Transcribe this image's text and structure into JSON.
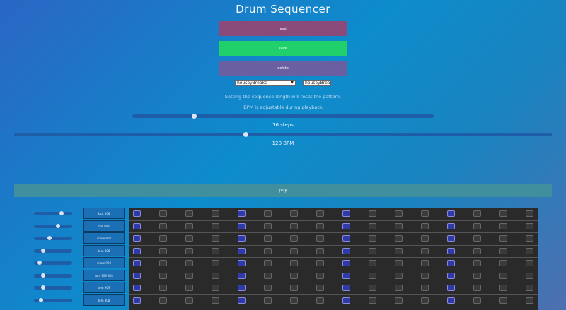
{
  "header": {
    "title": "Drum Sequencer"
  },
  "buttons": {
    "reset": "reset",
    "save": "save",
    "delete": "delete"
  },
  "controls": {
    "preset_select": "houseyBreaks",
    "name_input": "houseyBreaks",
    "note_reset": "Setting the sequence length will reset the pattern.",
    "note_bpm": "BPM is adjustable during playback",
    "steps_label": "16 steps",
    "steps_fraction": 0.2,
    "bpm_label": "120 BPM",
    "bpm_fraction": 0.43,
    "play_label": "play"
  },
  "tracks": [
    {
      "label": "kick 808",
      "volume": 0.75,
      "pattern": [
        1,
        0,
        0,
        0,
        1,
        0,
        0,
        0,
        1,
        0,
        0,
        0,
        1,
        0,
        0,
        0
      ]
    },
    {
      "label": "hat 808",
      "volume": 0.65,
      "pattern": [
        1,
        0,
        0,
        0,
        1,
        0,
        0,
        0,
        1,
        0,
        0,
        0,
        1,
        0,
        0,
        0
      ]
    },
    {
      "label": "snare 808",
      "volume": 0.4,
      "pattern": [
        1,
        0,
        0,
        0,
        1,
        0,
        0,
        0,
        1,
        0,
        0,
        0,
        1,
        0,
        0,
        0
      ]
    },
    {
      "label": "tom 808",
      "volume": 0.2,
      "pattern": [
        1,
        0,
        0,
        0,
        1,
        0,
        0,
        0,
        1,
        0,
        0,
        0,
        1,
        0,
        0,
        0
      ]
    },
    {
      "label": "snare 909",
      "volume": 0.1,
      "pattern": [
        1,
        0,
        0,
        0,
        1,
        0,
        0,
        0,
        1,
        0,
        0,
        0,
        1,
        0,
        0,
        0
      ]
    },
    {
      "label": "tom 909 808",
      "volume": 0.2,
      "pattern": [
        1,
        0,
        0,
        0,
        1,
        0,
        0,
        0,
        1,
        0,
        0,
        0,
        1,
        0,
        0,
        0
      ]
    },
    {
      "label": "tom 909",
      "volume": 0.2,
      "pattern": [
        1,
        0,
        0,
        0,
        1,
        0,
        0,
        0,
        1,
        0,
        0,
        0,
        1,
        0,
        0,
        0
      ]
    },
    {
      "label": "tom 808",
      "volume": 0.15,
      "pattern": [
        1,
        0,
        0,
        0,
        1,
        0,
        0,
        0,
        1,
        0,
        0,
        0,
        1,
        0,
        0,
        0
      ]
    }
  ]
}
